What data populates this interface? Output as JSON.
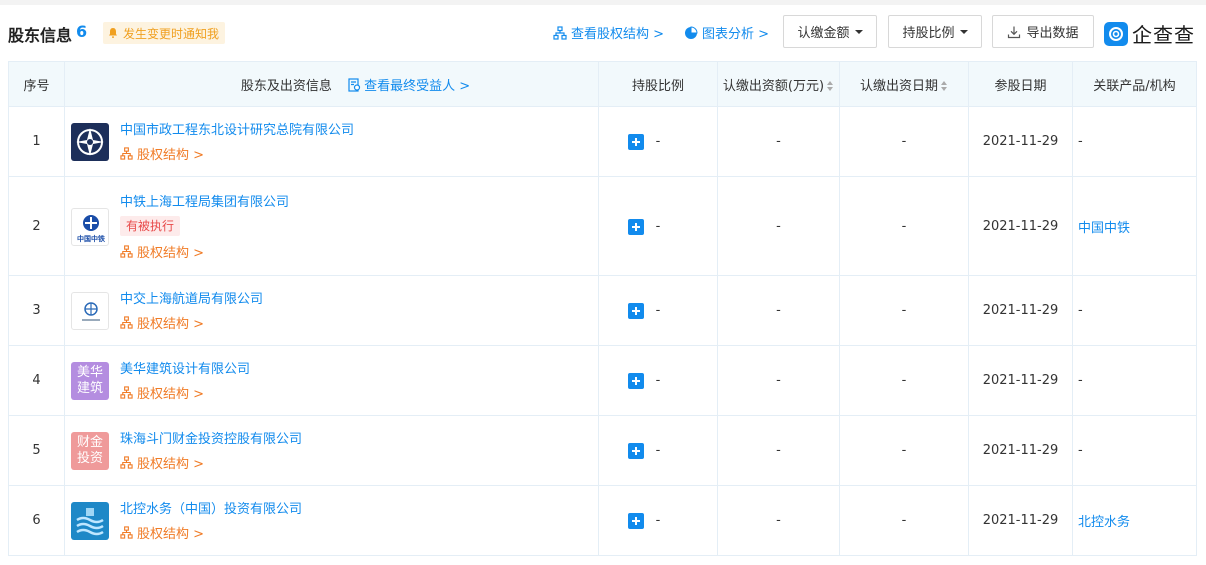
{
  "header": {
    "title": "股东信息",
    "count": "6",
    "notify_label": "发生变更时通知我",
    "equity_link": "查看股权结构 >",
    "chart_link": "图表分析 >",
    "btn_amount": "认缴金额",
    "btn_ratio": "持股比例",
    "btn_export": "导出数据",
    "logo_text": "企查查"
  },
  "table": {
    "col_index": "序号",
    "col_info": "股东及出资信息",
    "col_beneficiary": "查看最终受益人 >",
    "col_ratio": "持股比例",
    "col_amount": "认缴出资额(万元)",
    "col_date": "认缴出资日期",
    "col_join": "参股日期",
    "col_related": "关联产品/机构",
    "rows": [
      {
        "index": "1",
        "name": "中国市政工程东北设计研究总院有限公司",
        "tag": "",
        "equity": "股权结构 >",
        "ratio": "-",
        "amount": "-",
        "date": "-",
        "join": "2021-11-29",
        "related": "-",
        "logo": "emblem-icon",
        "logo_text": ""
      },
      {
        "index": "2",
        "name": "中铁上海工程局集团有限公司",
        "tag": "有被执行",
        "equity": "股权结构 >",
        "ratio": "-",
        "amount": "-",
        "date": "-",
        "join": "2021-11-29",
        "related": "中国中铁",
        "logo": "crec-logo",
        "logo_text": "中国中铁"
      },
      {
        "index": "3",
        "name": "中交上海航道局有限公司",
        "tag": "",
        "equity": "股权结构 >",
        "ratio": "-",
        "amount": "-",
        "date": "-",
        "join": "2021-11-29",
        "related": "-",
        "logo": "cccc-logo",
        "logo_text": ""
      },
      {
        "index": "4",
        "name": "美华建筑设计有限公司",
        "tag": "",
        "equity": "股权结构 >",
        "ratio": "-",
        "amount": "-",
        "date": "-",
        "join": "2021-11-29",
        "related": "-",
        "logo": "text-logo",
        "logo_text": "美华建筑"
      },
      {
        "index": "5",
        "name": "珠海斗门财金投资控股有限公司",
        "tag": "",
        "equity": "股权结构 >",
        "ratio": "-",
        "amount": "-",
        "date": "-",
        "join": "2021-11-29",
        "related": "-",
        "logo": "text-logo",
        "logo_text": "财金投资"
      },
      {
        "index": "6",
        "name": "北控水务（中国）投资有限公司",
        "tag": "",
        "equity": "股权结构 >",
        "ratio": "-",
        "amount": "-",
        "date": "-",
        "join": "2021-11-29",
        "related": "北控水务",
        "logo": "water-logo",
        "logo_text": ""
      }
    ]
  },
  "colors": {
    "accent": "#128bed",
    "equity_orange": "#f07b26",
    "header_bg": "#f2f9fc",
    "tag_red": "#e84a4a",
    "notify_bg": "#fdf3e0",
    "logo4_bg": "#b48de0",
    "logo5_bg": "#ef9a9a"
  }
}
